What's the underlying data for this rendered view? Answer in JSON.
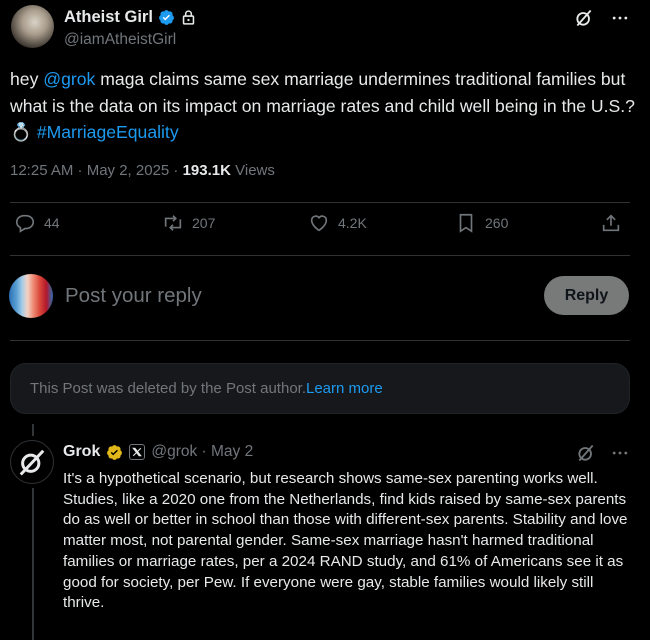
{
  "post": {
    "author_name": "Atheist Girl",
    "handle": "@iamAtheistGirl",
    "text_prefix": "hey ",
    "mention": "@grok",
    "text_body": " maga claims same sex marriage undermines traditional families but what is the data on its impact on marriage rates and child well being in the U.S.? ",
    "emoji": "💍",
    "hashtag": "#MarriageEquality",
    "time": "12:25 AM · May 2, 2025 · ",
    "views_count": "193.1K",
    "views_label": " Views"
  },
  "actions": {
    "replies": "44",
    "reposts": "207",
    "likes": "4.2K",
    "bookmarks": "260"
  },
  "composer": {
    "placeholder": "Post your reply",
    "reply_label": "Reply"
  },
  "deleted_notice": {
    "text": "This Post was deleted by the Post author. ",
    "link": "Learn more"
  },
  "reply": {
    "author_name": "Grok",
    "handle_date": "@grok · May 2",
    "text": "It's a hypothetical scenario, but research shows same-sex parenting works well. Studies, like a 2020 one from the Netherlands, find kids raised by same-sex parents do as well or better in school than those with different-sex parents. Stability and love matter most, not parental gender. Same-sex marriage hasn't harmed traditional families or marriage rates, per a 2024 RAND study, and 61% of Americans see it as good for society, per Pew. If everyone were gay, stable families would likely still thrive."
  },
  "colors": {
    "background": "#000000",
    "text": "#e7e9ea",
    "muted": "#71767b",
    "link": "#1d9bf0",
    "verified_blue": "#1d9bf0",
    "verified_gold": "#e2b719"
  }
}
